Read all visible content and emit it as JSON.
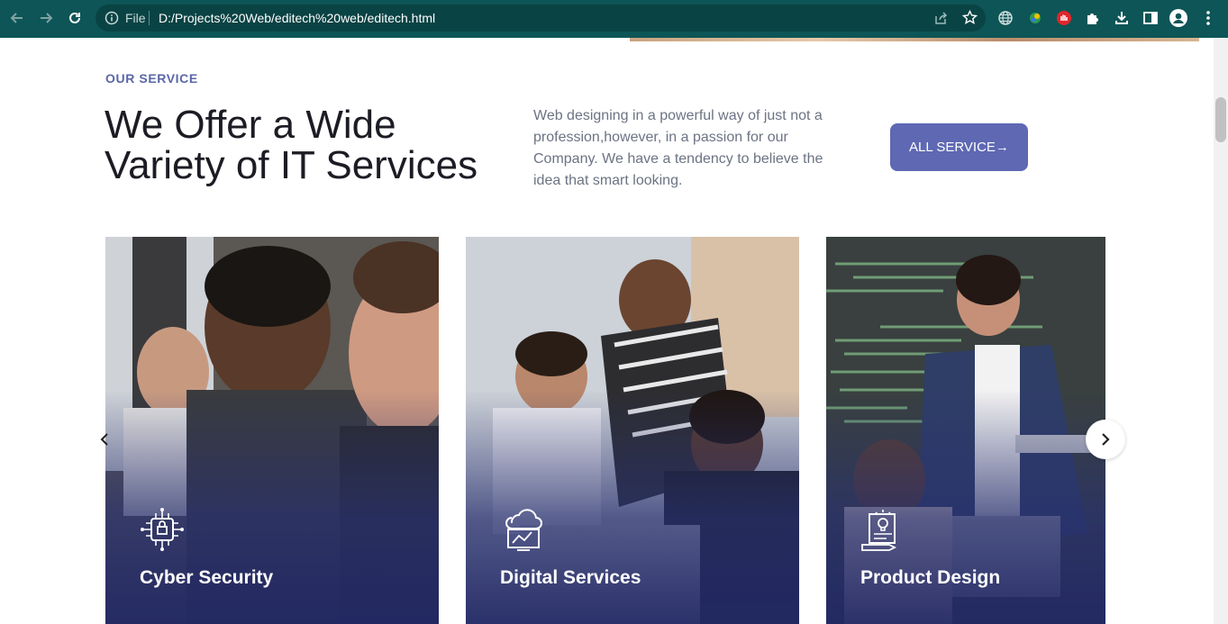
{
  "browser": {
    "file_label": "File",
    "url": "D:/Projects%20Web/editech%20web/editech.html"
  },
  "section": {
    "eyebrow": "OUR SERVICE",
    "headline": "We Offer a Wide Variety of IT Services",
    "blurb": "Web designing in a powerful way of just not a profession,however, in a passion for our Company. We have a tendency to believe the idea that smart looking.",
    "cta_label": "ALL SERVICE→"
  },
  "cards": [
    {
      "title": "Cyber Security",
      "icon": "security-chip-icon"
    },
    {
      "title": "Digital Services",
      "icon": "cloud-monitor-icon"
    },
    {
      "title": "Product Design",
      "icon": "idea-board-icon"
    }
  ],
  "colors": {
    "chrome": "#0d5556",
    "accent": "#5e68b3",
    "eyebrow": "#5a67a8",
    "card_overlay": "#28306e"
  }
}
